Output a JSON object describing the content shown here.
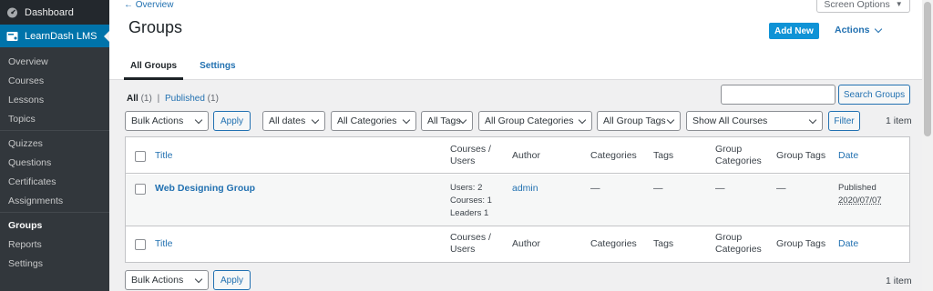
{
  "sidebar": {
    "dashboard": "Dashboard",
    "learndash": "LearnDash LMS",
    "items": [
      "Overview",
      "Courses",
      "Lessons",
      "Topics"
    ],
    "items2": [
      "Quizzes",
      "Questions",
      "Certificates",
      "Assignments"
    ],
    "items3": [
      "Groups",
      "Reports",
      "Settings"
    ]
  },
  "header": {
    "overview_link": "← Overview",
    "screen_options": "Screen Options",
    "title": "Groups",
    "add_new": "Add New",
    "actions": "Actions",
    "tabs": [
      "All Groups",
      "Settings"
    ]
  },
  "filters": {
    "all_label": "All",
    "all_count": "(1)",
    "separator": "|",
    "published_label": "Published",
    "published_count": "(1)",
    "search_button": "Search Groups",
    "bulk_actions": "Bulk Actions",
    "apply": "Apply",
    "dates": "All dates",
    "categories": "All Categories",
    "tags": "All Tags",
    "group_categories": "All Group Categories",
    "group_tags": "All Group Tags",
    "courses": "Show All Courses",
    "filter": "Filter",
    "item_count": "1 item"
  },
  "table": {
    "columns": {
      "title": "Title",
      "courses_users_1": "Courses /",
      "courses_users_2": "Users",
      "author": "Author",
      "categories": "Categories",
      "tags": "Tags",
      "group_categories_1": "Group",
      "group_categories_2": "Categories",
      "group_tags": "Group Tags",
      "date": "Date"
    },
    "rows": [
      {
        "title": "Web Designing Group",
        "users": "Users: 2",
        "courses": "Courses: 1",
        "leaders": "Leaders 1",
        "author": "admin",
        "categories": "—",
        "tags": "—",
        "group_categories": "—",
        "group_tags": "—",
        "status": "Published",
        "date": "2020/07/07"
      }
    ]
  },
  "colors": {
    "sidebar_bg": "#23282d",
    "active_menu": "#0073aa",
    "link": "#2271b1",
    "add_new_bg": "#0f93d6"
  }
}
